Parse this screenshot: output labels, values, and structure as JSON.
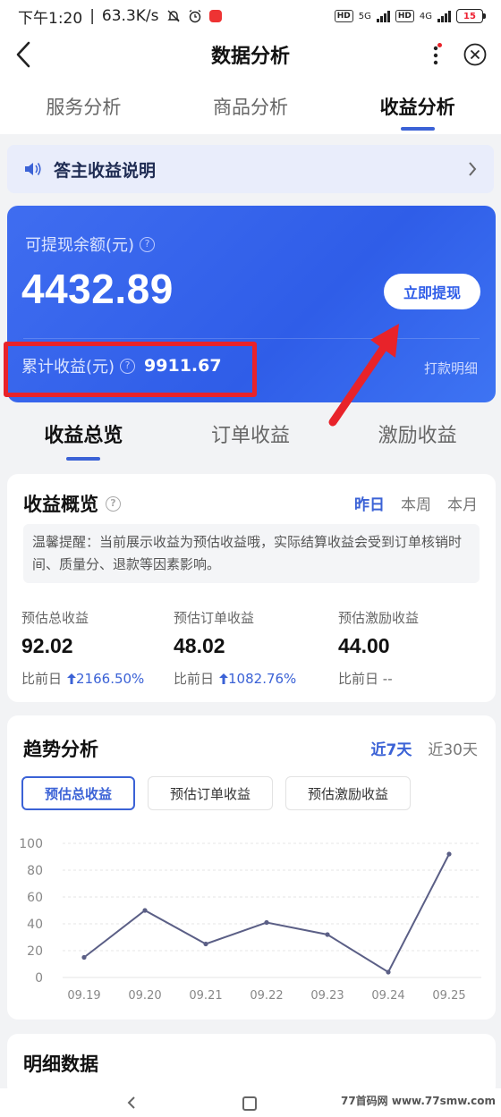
{
  "status_bar": {
    "time": "下午1:20",
    "speed": "63.3K/s",
    "hd1": "HD",
    "net1": "5G",
    "hd2": "HD",
    "net2": "4G",
    "battery": "15"
  },
  "header": {
    "title": "数据分析"
  },
  "top_tabs": [
    "服务分析",
    "商品分析",
    "收益分析"
  ],
  "notice": {
    "text": "答主收益说明"
  },
  "balance": {
    "label": "可提现余额(元)",
    "amount": "4432.89",
    "withdraw_label": "立即提现",
    "cumulative_label": "累计收益(元)",
    "cumulative_value": "9911.67",
    "payment_link": "打款明细"
  },
  "sub_tabs": [
    "收益总览",
    "订单收益",
    "激励收益"
  ],
  "overview": {
    "title": "收益概览",
    "periods": [
      "昨日",
      "本周",
      "本月"
    ],
    "tip": "温馨提醒：当前展示收益为预估收益哦，实际结算收益会受到订单核销时间、质量分、退款等因素影响。",
    "stats": [
      {
        "label": "预估总收益",
        "value": "92.02",
        "compare_label": "比前日",
        "change": "2166.50%"
      },
      {
        "label": "预估订单收益",
        "value": "48.02",
        "compare_label": "比前日",
        "change": "1082.76%"
      },
      {
        "label": "预估激励收益",
        "value": "44.00",
        "compare_label": "比前日",
        "change": "--"
      }
    ]
  },
  "trend": {
    "title": "趋势分析",
    "periods": [
      "近7天",
      "近30天"
    ],
    "chips": [
      "预估总收益",
      "预估订单收益",
      "预估激励收益"
    ]
  },
  "chart_data": {
    "type": "line",
    "x": [
      "09.19",
      "09.20",
      "09.21",
      "09.22",
      "09.23",
      "09.24",
      "09.25"
    ],
    "series": [
      {
        "values": [
          15,
          50,
          25,
          41,
          32,
          4,
          92
        ]
      }
    ],
    "yticks": [
      "100",
      "80",
      "60",
      "40",
      "20",
      "0"
    ],
    "ylim": [
      0,
      100
    ],
    "grid": true,
    "color": "#5b5f86"
  },
  "detail": {
    "title": "明细数据"
  },
  "watermark": "77首码网 www.77smw.com"
}
